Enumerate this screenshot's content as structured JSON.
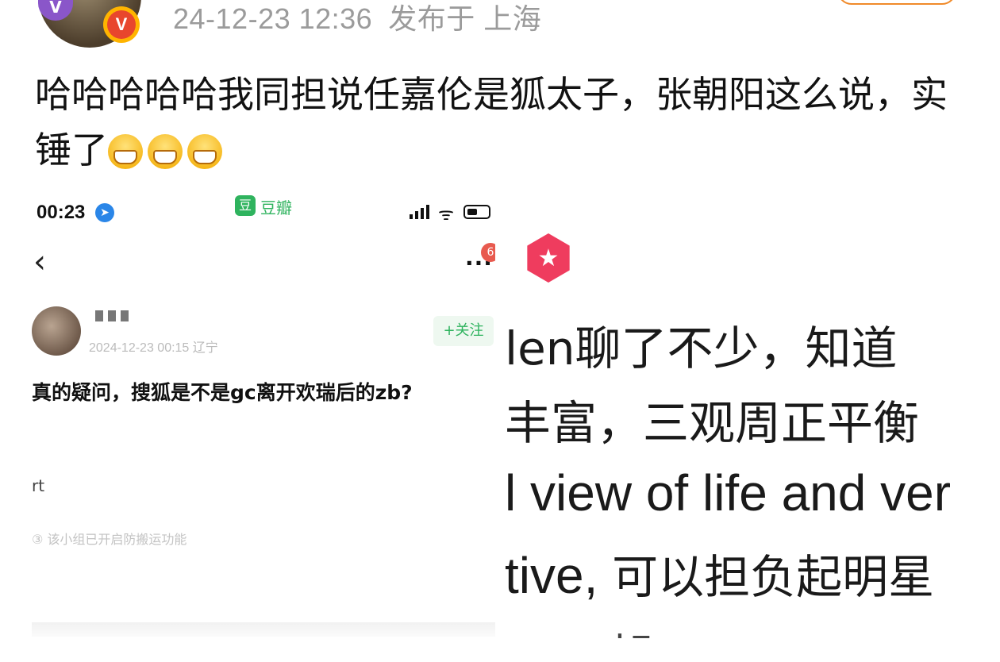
{
  "header": {
    "timestamp": "24-12-23 12:36",
    "location": "发布于 上海",
    "verified_badge": "V"
  },
  "post": {
    "text": "哈哈哈哈哈我同担说任嘉伦是狐太子，张朝阳这么说，实锤了",
    "emoji_icon": "grinning-face-icon"
  },
  "left_screenshot": {
    "status_time": "00:23",
    "app_name": "豆瓣",
    "app_icon_char": "豆",
    "more_label": "...",
    "notif_count": "6",
    "post_date": "2024-12-23 00:15 辽宁",
    "follow_label": "+关注",
    "question": "真的疑问，搜狐是不是gc离开欢瑞后的zb?",
    "rt_text": "rt",
    "anti_copy_notice": "③ 该小组已开启防搬运功能"
  },
  "right_screenshot": {
    "badge_icon": "star-icon",
    "line1": "len聊了不少，知道",
    "line2": "丰富，三观周正平衡",
    "line3": "l view of life and ver",
    "line4_latin": "tive, ",
    "line4_cjk": "可以担负起明星",
    "line5": "...... 朝 ..."
  },
  "colors": {
    "meta_gray": "#9b9b9b",
    "douban_green": "#2fb35e",
    "verified_orange": "#ffb400",
    "verified_red": "#e8462d",
    "star_badge": "#ef3c5e"
  }
}
